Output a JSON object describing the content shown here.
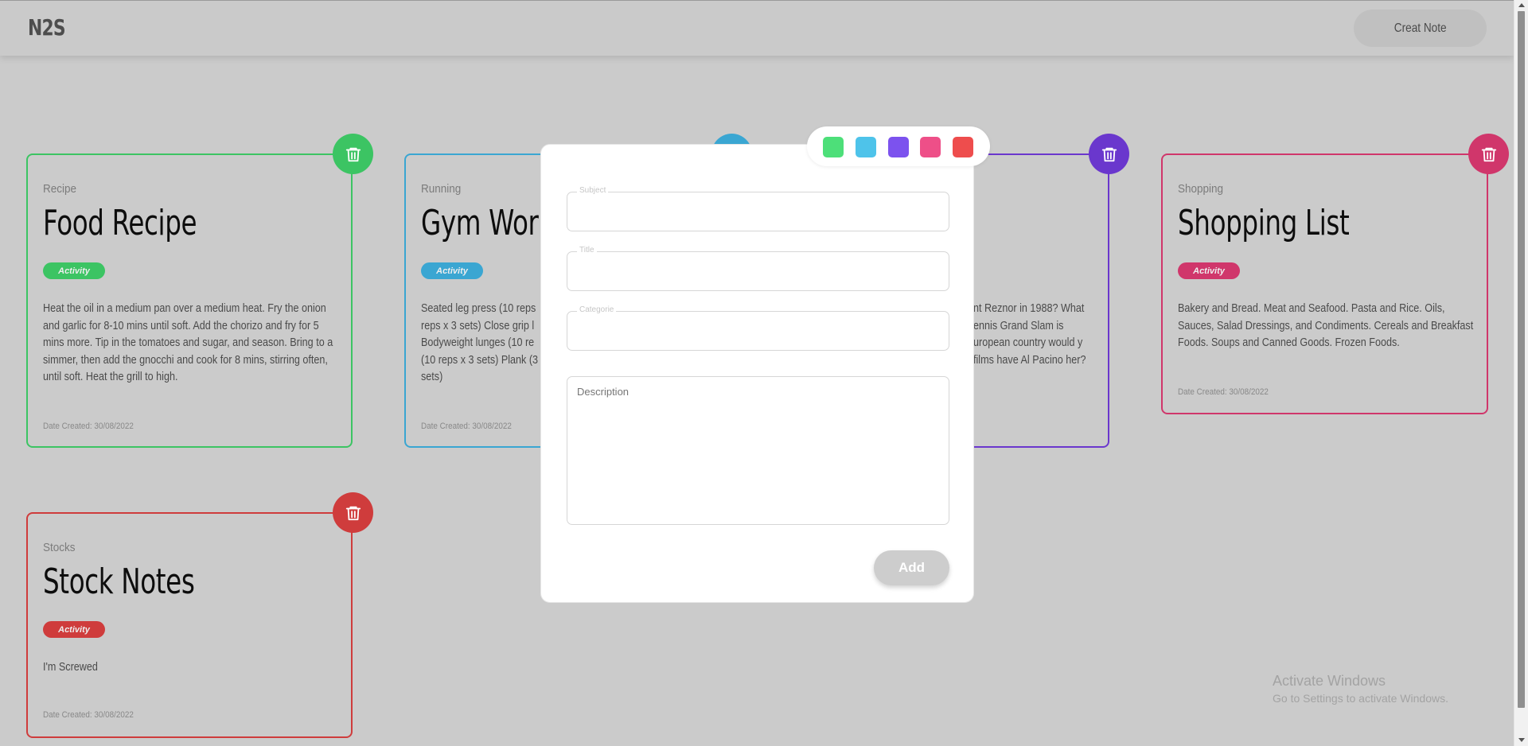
{
  "app": {
    "logo": "N2S",
    "create_label": "Creat Note"
  },
  "notes": [
    {
      "id": "recipe",
      "subject": "Recipe",
      "title": "Food Recipe",
      "badge": "Activity",
      "description": "Heat the oil in a medium pan over a medium heat. Fry the onion and garlic for 8-10 mins until soft. Add the chorizo and fry for 5 mins more. Tip in the tomatoes and sugar, and season. Bring to a simmer, then add the gnocchi and cook for 8 mins, stirring often, until soft. Heat the grill to high.",
      "date": "Date Created: 30/08/2022",
      "color": "#3cc463"
    },
    {
      "id": "running",
      "subject": "Running",
      "title": "Gym Wor",
      "badge": "Activity",
      "description": "Seated leg press (10 reps reps x 3 sets) Close grip l Bodyweight lunges (10 re (10 reps x 3 sets) Plank (3 sets)",
      "date": "Date Created: 30/08/2022",
      "color": "#3aa6d2"
    },
    {
      "id": "trivia",
      "subject": "",
      "title": "",
      "badge": "",
      "description": "nt Reznor in 1988? What ennis Grand Slam is uropean country would y films have Al Pacino her?",
      "date": "",
      "color": "#6a37cd"
    },
    {
      "id": "shopping",
      "subject": "Shopping",
      "title": "Shopping List",
      "badge": "Activity",
      "description": "Bakery and Bread. Meat and Seafood. Pasta and Rice. Oils, Sauces, Salad Dressings, and Condiments. Cereals and Breakfast Foods. Soups and Canned Goods. Frozen Foods.",
      "date": "Date Created: 30/08/2022",
      "color": "#d0366b"
    },
    {
      "id": "stocks",
      "subject": "Stocks",
      "title": "Stock Notes",
      "badge": "Activity",
      "description": "I'm Screwed",
      "date": "Date Created: 30/08/2022",
      "color": "#cf3c3c"
    }
  ],
  "modal": {
    "colors": [
      "#4ddf79",
      "#4ec3ea",
      "#7c52ee",
      "#ee4f88",
      "#ee4d4d"
    ],
    "fields": {
      "subject": "Subject",
      "title": "Title",
      "categorie": "Categorie"
    },
    "description_placeholder": "Description",
    "add_label": "Add"
  },
  "watermark": {
    "line1": "Activate Windows",
    "line2": "Go to Settings to activate Windows."
  }
}
